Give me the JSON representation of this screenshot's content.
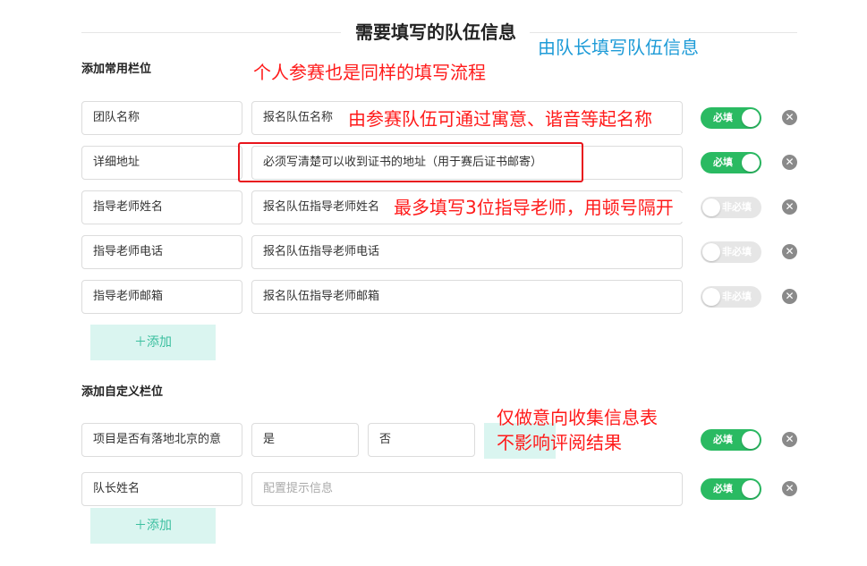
{
  "header": {
    "title": "需要填写的队伍信息"
  },
  "sections": {
    "common": "添加常用栏位",
    "custom": "添加自定义栏位"
  },
  "common_rows": [
    {
      "name": "团队名称",
      "hint": "报名队伍名称",
      "hint_is_placeholder": false,
      "toggle": "必填",
      "on": true
    },
    {
      "name": "详细地址",
      "hint": "必须写清楚可以收到证书的地址（用于赛后证书邮寄）",
      "hint_is_placeholder": false,
      "toggle": "必填",
      "on": true
    },
    {
      "name": "指导老师姓名",
      "hint": "报名队伍指导老师姓名",
      "hint_is_placeholder": false,
      "toggle": "非必填",
      "on": false
    },
    {
      "name": "指导老师电话",
      "hint": "报名队伍指导老师电话",
      "hint_is_placeholder": false,
      "toggle": "非必填",
      "on": false
    },
    {
      "name": "指导老师邮箱",
      "hint": "报名队伍指导老师邮箱",
      "hint_is_placeholder": false,
      "toggle": "非必填",
      "on": false
    }
  ],
  "custom_rows": [
    {
      "name": "项目是否有落地北京的意",
      "options": [
        "是",
        "否"
      ],
      "toggle": "必填",
      "on": true
    },
    {
      "name": "队长姓名",
      "hint": "配置提示信息",
      "hint_is_placeholder": true,
      "toggle": "必填",
      "on": true
    }
  ],
  "buttons": {
    "add": "＋添加"
  },
  "icons": {
    "close": "close-icon",
    "plus": "plus-icon"
  },
  "annotations": {
    "captain": "由队长填写队伍信息",
    "individual": "个人参赛也是同样的填写流程",
    "team_name": "由参赛队伍可通过寓意、谐音等起名称",
    "teachers": "最多填写3位指导老师，用顿号隔开",
    "intent_line1": "仅做意向收集信息表",
    "intent_line2": "不影响评阅结果"
  },
  "colors": {
    "toggle_on": "#2aba62",
    "toggle_off": "#e6e6e6",
    "add_button_bg": "#daf5f0",
    "add_button_text": "#3bbf9f",
    "annotation_red": "#ff1a1a",
    "annotation_blue": "#1e9bd7",
    "highlight_box": "#e8141b"
  }
}
